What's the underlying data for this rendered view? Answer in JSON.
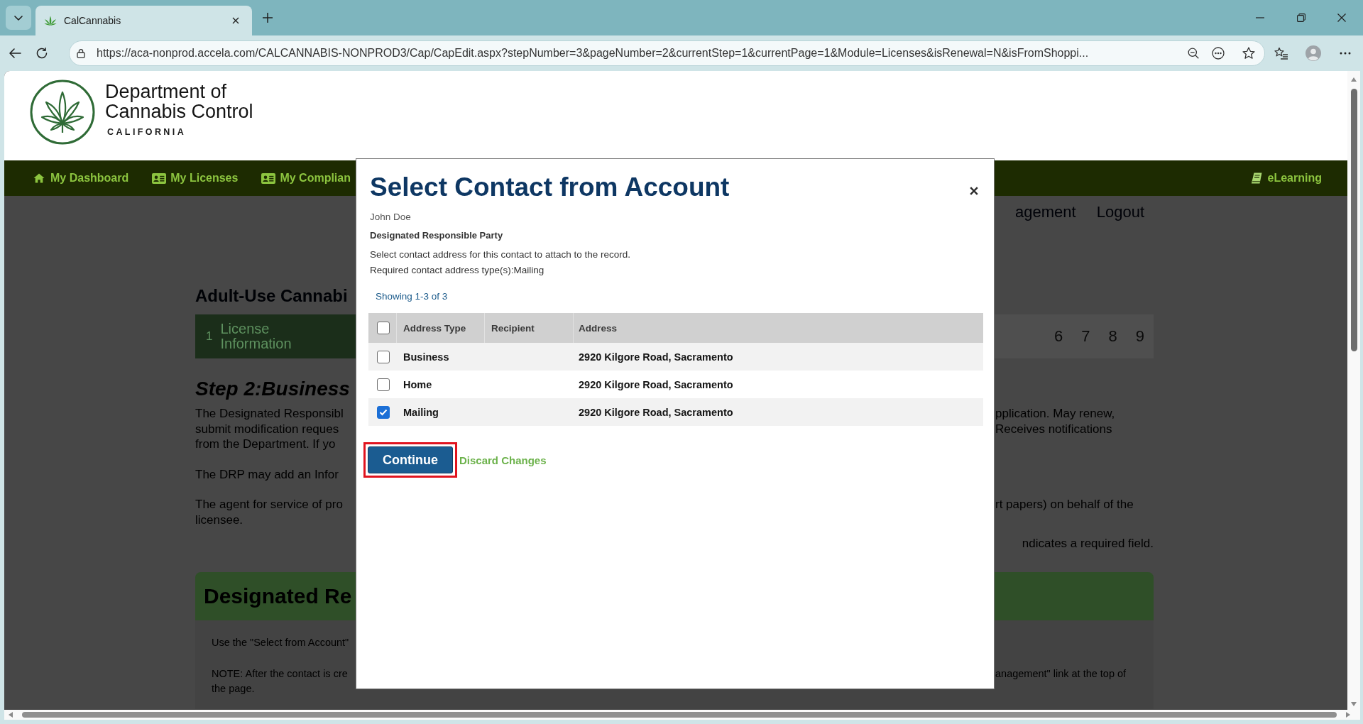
{
  "browser": {
    "tabs": [
      {
        "title": "CalCannabis",
        "selected": true
      }
    ],
    "address_bar": {
      "url": "https://aca-nonprod.accela.com/CALCANNABIS-NONPROD3/Cap/CapEdit.aspx?stepNumber=3&pageNumber=2&currentStep=1&currentPage=1&Module=Licenses&isRenewal=N&isFromShoppi..."
    }
  },
  "header": {
    "logo_lines": [
      "Department of",
      "Cannabis Control"
    ],
    "logo_state": "CALIFORNIA"
  },
  "nav": {
    "items": [
      {
        "kind": "home",
        "label": "My Dashboard"
      },
      {
        "kind": "card",
        "label": "My Licenses"
      },
      {
        "kind": "card",
        "label": "My Complian"
      }
    ],
    "right_items": [
      {
        "kind": "book",
        "label": "eLearning"
      }
    ]
  },
  "background_page": {
    "account_links": [
      "agement",
      "Logout"
    ],
    "title": "Adult-Use Cannabi",
    "steps": {
      "left": [
        {
          "number": "1",
          "label": "License Information",
          "selected": true
        }
      ],
      "right": [
        {
          "number": "6",
          "selected": false
        },
        {
          "number": "7",
          "selected": false
        },
        {
          "number": "8",
          "selected": false
        },
        {
          "number": "9",
          "selected": false
        }
      ]
    },
    "step_heading": "Step 2:Business",
    "paragraphs": [
      [
        {
          "left": "The Designated Responsibl",
          "right": "pplication. May renew,"
        },
        {
          "left": "submit modification reques",
          "right": "Receives notifications"
        },
        {
          "left": "from the Department. If yo"
        }
      ],
      [
        {
          "left": "The DRP may add an Infor"
        }
      ],
      [
        {
          "left": "The agent for service of pro",
          "right": "rt papers) on behalf of the"
        },
        {
          "left": "licensee."
        }
      ]
    ],
    "required_note": "ndicates a required field.",
    "section": {
      "title": "Designated Re",
      "paragraphs": [
        [
          {
            "left": "Use the \"Select from Account\""
          }
        ],
        [
          {
            "left": "NOTE: After the contact is cre",
            "right": "anagement\" link at the top of"
          },
          {
            "left": "the page."
          }
        ]
      ]
    }
  },
  "dialog": {
    "title": "Select Contact from Account",
    "contact_name": "John Doe",
    "contact_type": "Designated Responsible Party",
    "instructions": [
      "Select contact address for this contact to attach to the record.",
      "Required contact address type(s):Mailing"
    ],
    "result_count": "Showing 1-3 of 3",
    "table": {
      "select_all_checked": false,
      "columns": [
        "Address Type",
        "Recipient",
        "Address"
      ],
      "rows": [
        {
          "address_type": "Business",
          "address": "2920 Kilgore Road, Sacramento",
          "checked": false
        },
        {
          "address_type": "Home",
          "address": "2920 Kilgore Road, Sacramento",
          "checked": false
        },
        {
          "address_type": "Mailing",
          "address": "2920 Kilgore Road, Sacramento",
          "checked": true
        }
      ]
    },
    "continue_button": {
      "label": "Continue",
      "highlighted": true
    },
    "discard_link": "Discard Changes"
  }
}
